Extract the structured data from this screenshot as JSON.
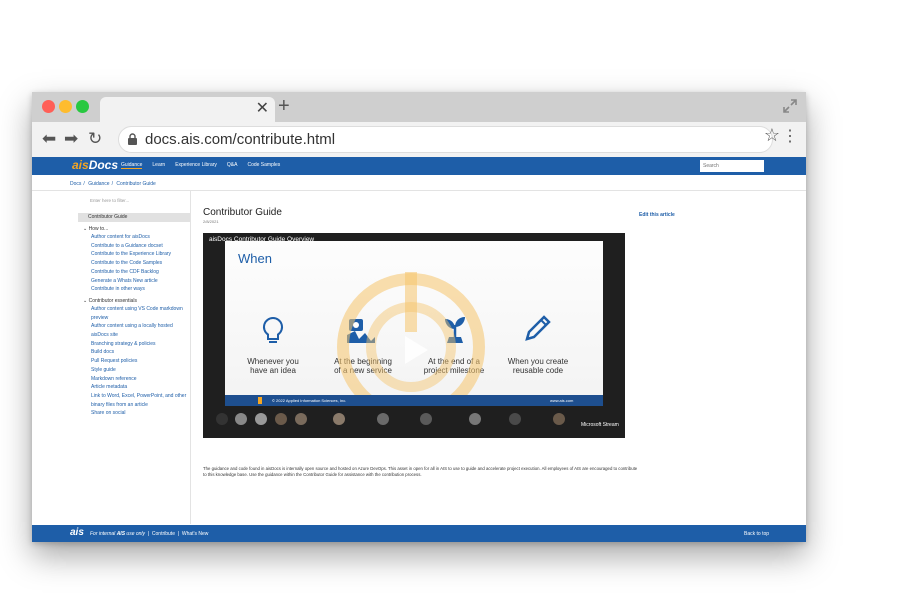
{
  "browser": {
    "url": "docs.ais.com/contribute.html"
  },
  "site": {
    "brand_prefix": "ais",
    "brand_suffix": "Docs",
    "nav": [
      "Guidance",
      "Learn",
      "Experience Library",
      "Q&A",
      "Code Samples"
    ],
    "active_nav": "Guidance",
    "search_placeholder": "Search"
  },
  "breadcrumbs": [
    "Docs",
    "/",
    "Guidance",
    "/",
    "Contributor Guide"
  ],
  "sidebar": {
    "filter_placeholder": "Enter here to filter...",
    "selected": "Contributor Guide",
    "group1": "How to...",
    "group1_items": [
      "Author content for aisDocs",
      "Contribute to a Guidance docset",
      "Contribute to the Experience Library",
      "Contribute to the Code Samples",
      "Contribute to the CDF Backlog",
      "Generate a Whats New article",
      "Contribute in other ways"
    ],
    "group2": "Contributor essentials",
    "group2_items": [
      "Author content using VS Code markdown preview",
      "Author content using a locally hosted aisDocs site",
      "Branching strategy & policies",
      "Build docs",
      "Pull Request policies",
      "Style guide",
      "Markdown reference",
      "Article metadata",
      "Link to Word, Excel, PowerPoint, and other binary files from an article",
      "Share on social"
    ]
  },
  "article": {
    "title": "Contributor Guide",
    "date": "2/8/2021",
    "edit_link": "Edit this article",
    "description": "The guidance and code found in aisDocs is internally open source and hosted on Azure DevOps. This asset in open for all in AIS to use to guide and accelerate project execution. All employees of AIS are encouraged to contribute to this knowledge base. Use the guidance within the Contributor Guide for assistance with the contribution process."
  },
  "video": {
    "title": "aisDocs Contributor Guide Overview",
    "heading": "When",
    "captions": [
      [
        "Whenever you",
        "have an idea"
      ],
      [
        "At the beginning",
        "of a new service"
      ],
      [
        "At the end of a",
        "project milestone"
      ],
      [
        "When you create",
        "reusable code"
      ]
    ],
    "icons": [
      "lightbulb-icon",
      "deploy-icon",
      "plant-icon",
      "pencil-icon"
    ],
    "footer_copyright": "© 2022 Applied Information Sciences, Inc.",
    "footer_url": "www.ais.com",
    "stream_label": "Microsoft Stream"
  },
  "footer": {
    "logo": "ais",
    "text_prefix": "For internal ",
    "text_bold": "AIS",
    "text_suffix": " use only",
    "links": [
      "Contribute",
      "What's New"
    ],
    "back_to_top": "Back to top"
  },
  "colors": {
    "brand_blue": "#1e5ea8",
    "accent_orange": "#f5a623"
  }
}
